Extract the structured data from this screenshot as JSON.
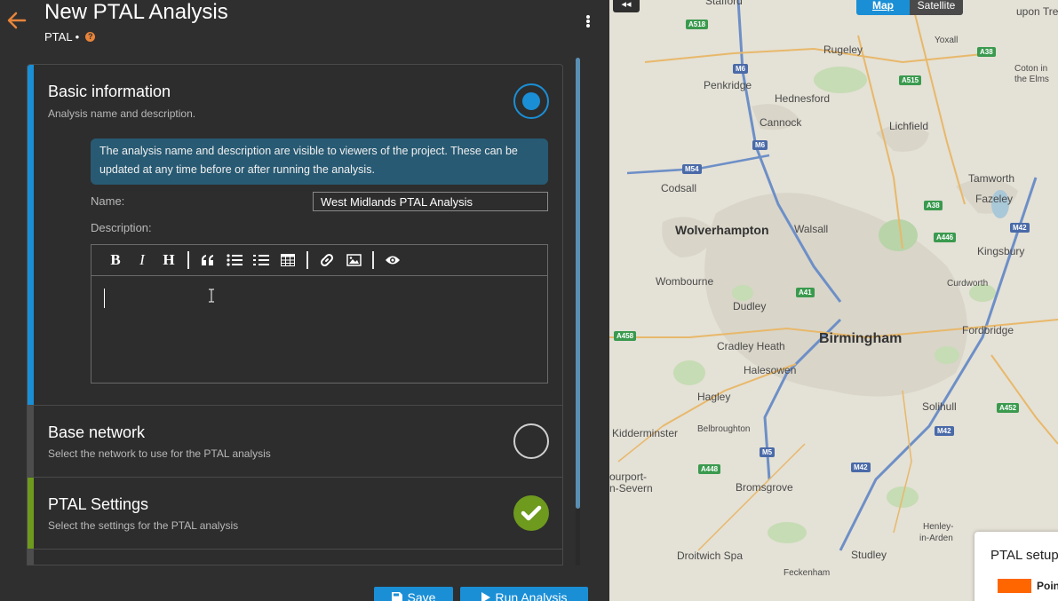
{
  "header": {
    "title": "New PTAL Analysis",
    "subtitle": "PTAL •",
    "help_icon": "?"
  },
  "sections": {
    "basic": {
      "title": "Basic information",
      "description": "Analysis name and description.",
      "info": "The analysis name and description are visible to viewers of the project. These can be updated at any time before or after running the analysis.",
      "name_label": "Name:",
      "name_value": "West Midlands PTAL Analysis",
      "description_label": "Description:",
      "status": "active"
    },
    "network": {
      "title": "Base network",
      "description": "Select the network to use for the PTAL analysis",
      "status": "incomplete"
    },
    "settings": {
      "title": "PTAL Settings",
      "description": "Select the settings for the PTAL analysis",
      "status": "complete"
    }
  },
  "editor_toolbar": {
    "bold": "B",
    "italic": "I",
    "heading": "H"
  },
  "buttons": {
    "save": "Save",
    "run": "Run Analysis"
  },
  "map": {
    "toggle_map": "Map",
    "toggle_satellite": "Satellite",
    "collapse": "◂◂",
    "places": {
      "stafford": "Stafford",
      "upton": "upon Tren",
      "yoxall": "Yoxall",
      "rugeley": "Rugeley",
      "coton": "Coton in",
      "the_elms": "the Elms",
      "penkridge": "Penkridge",
      "hednesford": "Hednesford",
      "cannock": "Cannock",
      "lichfield": "Lichfield",
      "codsall": "Codsall",
      "tamworth": "Tamworth",
      "fazeley": "Fazeley",
      "wolverhampton": "Wolverhampton",
      "walsall": "Walsall",
      "kingsbury": "Kingsbury",
      "wombourne": "Wombourne",
      "curdworth": "Curdworth",
      "dudley": "Dudley",
      "cradley": "Cradley Heath",
      "birmingham": "Birmingham",
      "fordbridge": "Fordbridge",
      "halesowen": "Halesowen",
      "hagley": "Hagley",
      "solihull": "Solihull",
      "kidderminster": "Kidderminster",
      "belbroughton": "Belbroughton",
      "stourport1": "ourport-",
      "stourport2": "n-Severn",
      "bromsgrove": "Bromsgrove",
      "henley1": "Henley-",
      "henley2": "in-Arden",
      "droitwich": "Droitwich Spa",
      "studley": "Studley",
      "feckenham": "Feckenham"
    },
    "roads": {
      "a518": "A518",
      "m6a": "M6",
      "a38a": "A38",
      "a515": "A515",
      "m6b": "M6",
      "m54": "M54",
      "a38b": "A38",
      "a446": "A446",
      "m42a": "M42",
      "a41": "A41",
      "a458": "A458",
      "a452": "A452",
      "m42b": "M42",
      "m5": "M5",
      "a448": "A448",
      "m42c": "M42"
    },
    "legend": {
      "title": "PTAL setup",
      "item": "Poin",
      "item_color": "#ff6600"
    }
  },
  "colors": {
    "accent": "#1a8fd6",
    "complete": "#6e9a1e",
    "back_arrow": "#e8843a"
  }
}
